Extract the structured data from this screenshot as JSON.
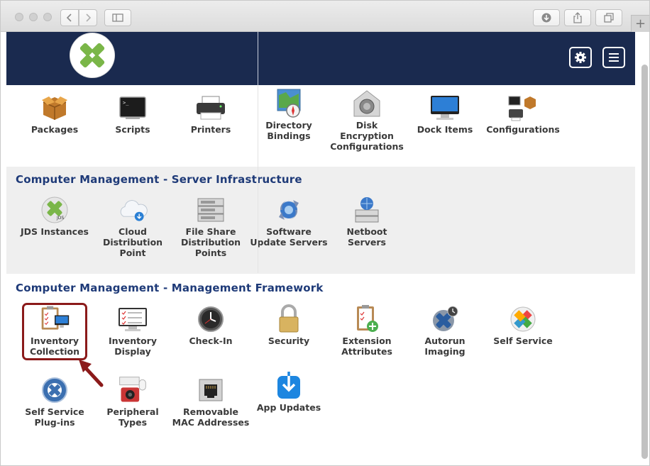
{
  "browser": {
    "toolbar": {
      "back_icon": "chevron-left-icon",
      "forward_icon": "chevron-right-icon",
      "sidebar_icon": "sidebar-icon",
      "download_icon": "download-icon",
      "share_icon": "share-icon",
      "tabs_icon": "tabs-icon",
      "new_tab_label": "+"
    }
  },
  "header": {
    "logo_icon": "jamf-logo-icon",
    "settings_icon": "gear-icon",
    "menu_icon": "hamburger-icon",
    "background_color": "#1a2a4f"
  },
  "top_row": [
    {
      "label": "Packages",
      "icon": "package-icon"
    },
    {
      "label": "Scripts",
      "icon": "terminal-icon"
    },
    {
      "label": "Printers",
      "icon": "printer-icon"
    },
    {
      "label": "Directory Bindings",
      "icon": "directory-icon"
    },
    {
      "label": "Disk Encryption Configurations",
      "icon": "disk-encryption-icon"
    },
    {
      "label": "Dock Items",
      "icon": "monitor-icon"
    },
    {
      "label": "Configurations",
      "icon": "configurations-icon"
    }
  ],
  "server_infrastructure": {
    "title": "Computer Management - Server Infrastructure",
    "items": [
      {
        "label": "JDS Instances",
        "icon": "jds-icon"
      },
      {
        "label": "Cloud Distribution Point",
        "icon": "cloud-icon"
      },
      {
        "label": "File Share Distribution Points",
        "icon": "server-rack-icon"
      },
      {
        "label": "Software Update Servers",
        "icon": "software-update-icon"
      },
      {
        "label": "Netboot Servers",
        "icon": "netboot-icon"
      }
    ]
  },
  "management_framework": {
    "title": "Computer Management - Management Framework",
    "items": [
      {
        "label": "Inventory Collection",
        "icon": "clipboard-monitor-icon"
      },
      {
        "label": "Inventory Display",
        "icon": "inventory-display-icon"
      },
      {
        "label": "Check-In",
        "icon": "clock-icon"
      },
      {
        "label": "Security",
        "icon": "padlock-icon"
      },
      {
        "label": "Extension Attributes",
        "icon": "clipboard-plus-icon"
      },
      {
        "label": "Autorun Imaging",
        "icon": "autorun-icon"
      },
      {
        "label": "Self Service",
        "icon": "self-service-icon"
      },
      {
        "label": "Self Service Plug-ins",
        "icon": "plugin-icon"
      },
      {
        "label": "Peripheral Types",
        "icon": "peripheral-icon"
      },
      {
        "label": "Removable MAC Addresses",
        "icon": "ethernet-port-icon"
      },
      {
        "label": "App Updates",
        "icon": "app-updates-icon"
      }
    ]
  },
  "colors": {
    "section_title": "#1e3a78",
    "highlight": "#8b1a1a",
    "jamf_green": "#7ab648"
  }
}
